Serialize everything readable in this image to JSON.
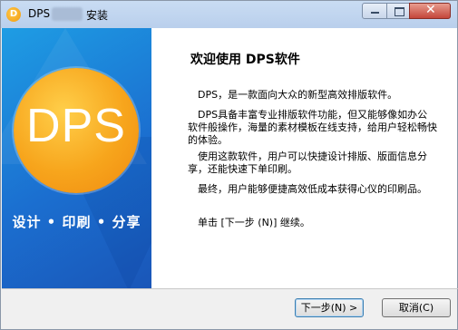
{
  "window": {
    "title": "DPS",
    "title_suffix": "安装",
    "app_icon_letter": "D",
    "accent": "#1b6fd0",
    "logo_color": "#f7a51c"
  },
  "banner": {
    "logo_text": "DPS",
    "slogan": "设计 • 印刷 • 分享"
  },
  "content": {
    "heading": "欢迎使用 DPS软件",
    "paragraphs": [
      "DPS，是一款面向大众的新型高效排版软件。",
      "DPS具备丰富专业排版软件功能，但又能够像如办公软件般操作，海量的素材模板在线支持，给用户轻松畅快的体验。",
      "使用这款软件，用户可以快捷设计排版、版面信息分享，还能快速下单印刷。",
      "最终，用户能够便捷高效低成本获得心仪的印刷品。",
      "单击 [下一步 (N)] 继续。"
    ]
  },
  "buttons": {
    "next": "下一步(N) >",
    "cancel": "取消(C)"
  }
}
